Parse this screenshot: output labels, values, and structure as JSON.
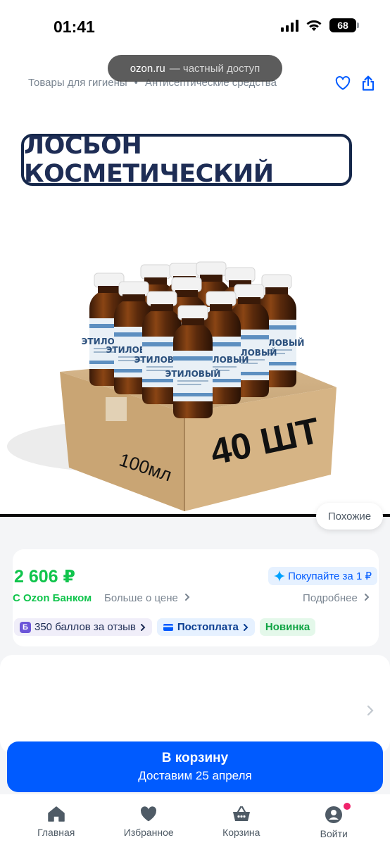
{
  "status_bar": {
    "time": "01:41",
    "battery": "68"
  },
  "browser": {
    "domain": "ozon.ru",
    "access": "— частный доступ"
  },
  "breadcrumb": {
    "items": [
      "Товары для гигиены",
      "Антисептические средства"
    ],
    "separator": "•"
  },
  "product": {
    "banner_text": "ЛОСЬОН КОСМЕТИЧЕСКИЙ",
    "pack_label": "40 ШТ",
    "volume_label": "100мл",
    "bottle_label": "ЭТИЛОВЫЙ"
  },
  "similar_label": "Похожие",
  "price": {
    "value": "2 606 ₽",
    "bank_label": "С Ozon Банком",
    "more_label": "Больше о цене",
    "buy_for_label": "Покупайте за 1 ₽",
    "details_label": "Подробнее"
  },
  "chips": {
    "points": "350 баллов за отзыв",
    "points_badge": "Б",
    "postpay": "Постоплата",
    "new": "Новинка"
  },
  "cta": {
    "title": "В корзину",
    "subtitle": "Доставим 25 апреля"
  },
  "tabs": [
    "Главная",
    "Избранное",
    "Корзина",
    "Войти"
  ],
  "colors": {
    "accent": "#005bff",
    "price": "#10c44c",
    "badge": "#f0236b"
  }
}
